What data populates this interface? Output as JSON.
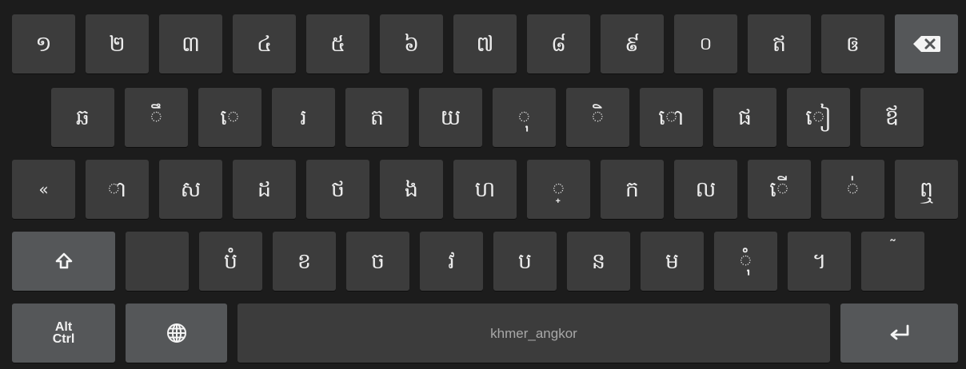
{
  "keyboard": {
    "layout_name": "khmer_angkor",
    "row1": [
      "១",
      "២",
      "៣",
      "៤",
      "៥",
      "៦",
      "៧",
      "៨",
      "៩",
      "០",
      "ឥ",
      "ឲ"
    ],
    "row2": [
      "ឆ",
      "◌ឹ",
      "◌េ",
      "រ",
      "ត",
      "យ",
      "◌ុ",
      "◌ិ",
      "◌ោ",
      "ផ",
      "◌ៀ",
      "ឪ"
    ],
    "row3": [
      "«",
      "◌ា",
      "ស",
      "ដ",
      "ថ",
      "ង",
      "ហ",
      "◌្",
      "ក",
      "ល",
      "◌ើ",
      "◌់",
      "ឮ"
    ],
    "row4": [
      "",
      "បំ",
      "ខ",
      "ច",
      "វ",
      "ប",
      "ន",
      "ម",
      "◌ុំ",
      "។",
      "˜"
    ],
    "alt_ctrl_label_top": "Alt",
    "alt_ctrl_label_bottom": "Ctrl",
    "icons": {
      "backspace": "backspace-icon",
      "shift": "shift-arrow-icon",
      "language": "globe-icon",
      "enter": "enter-return-icon"
    },
    "colors": {
      "background": "#1c1c1c",
      "key": "#3c3c3c",
      "function_key": "#555759",
      "text": "#ececec"
    }
  }
}
